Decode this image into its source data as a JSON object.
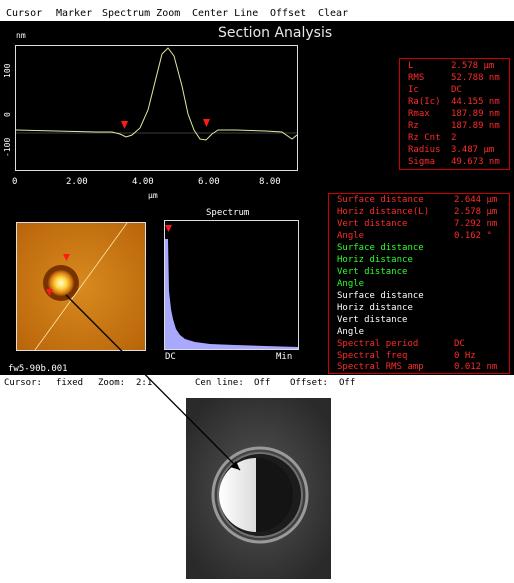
{
  "menu": [
    "Cursor",
    "Marker",
    "Spectrum Zoom",
    "Center Line",
    "Offset",
    "Clear"
  ],
  "title": "Section Analysis",
  "profile": {
    "y_unit": "nm",
    "y_ticks": [
      "100",
      "0",
      "-100"
    ],
    "x_ticks": [
      "0",
      "2.00",
      "4.00",
      "6.00",
      "8.00"
    ],
    "x_unit": "µm"
  },
  "stats": [
    {
      "k": "L",
      "v": "2.578 µm"
    },
    {
      "k": "RMS",
      "v": "52.788 nm"
    },
    {
      "k": "Ic",
      "v": "DC"
    },
    {
      "k": "Ra(Ic)",
      "v": "44.155 nm"
    },
    {
      "k": "Rmax",
      "v": "187.89 nm"
    },
    {
      "k": "Rz",
      "v": "187.89 nm"
    },
    {
      "k": "Rz Cnt",
      "v": "2"
    },
    {
      "k": "Radius",
      "v": "3.487 µm"
    },
    {
      "k": "Sigma",
      "v": "49.673 nm"
    }
  ],
  "measure_red": [
    {
      "k": "Surface distance",
      "v": "2.644 µm"
    },
    {
      "k": "Horiz distance(L)",
      "v": "2.578 µm"
    },
    {
      "k": "Vert distance",
      "v": "7.292 nm"
    },
    {
      "k": "Angle",
      "v": "0.162 °"
    }
  ],
  "measure_green": [
    "Surface distance",
    "Horiz distance",
    "Vert distance",
    "Angle"
  ],
  "measure_white": [
    "Surface distance",
    "Horiz distance",
    "Vert distance",
    "Angle"
  ],
  "spectral": [
    {
      "k": "Spectral period",
      "v": "DC"
    },
    {
      "k": "Spectral freq",
      "v": "0 Hz"
    },
    {
      "k": "Spectral RMS amp",
      "v": "0.012 nm"
    }
  ],
  "spectrum": {
    "title": "Spectrum",
    "x_left": "DC",
    "x_right": "Min"
  },
  "filename": "fw5-90b.001",
  "status": [
    {
      "k": "Cursor:",
      "v": "fixed"
    },
    {
      "k": "Zoom:",
      "v": "2:1"
    },
    {
      "k": "Cen line:",
      "v": "Off"
    },
    {
      "k": "Offset:",
      "v": "Off"
    }
  ],
  "colors": {
    "trace": "#e6e6a0",
    "marker": "#ff1a1a",
    "red_text": "#ff2a2a",
    "green_text": "#2aff2a",
    "spectrum_fill": "#a8a8ff"
  }
}
